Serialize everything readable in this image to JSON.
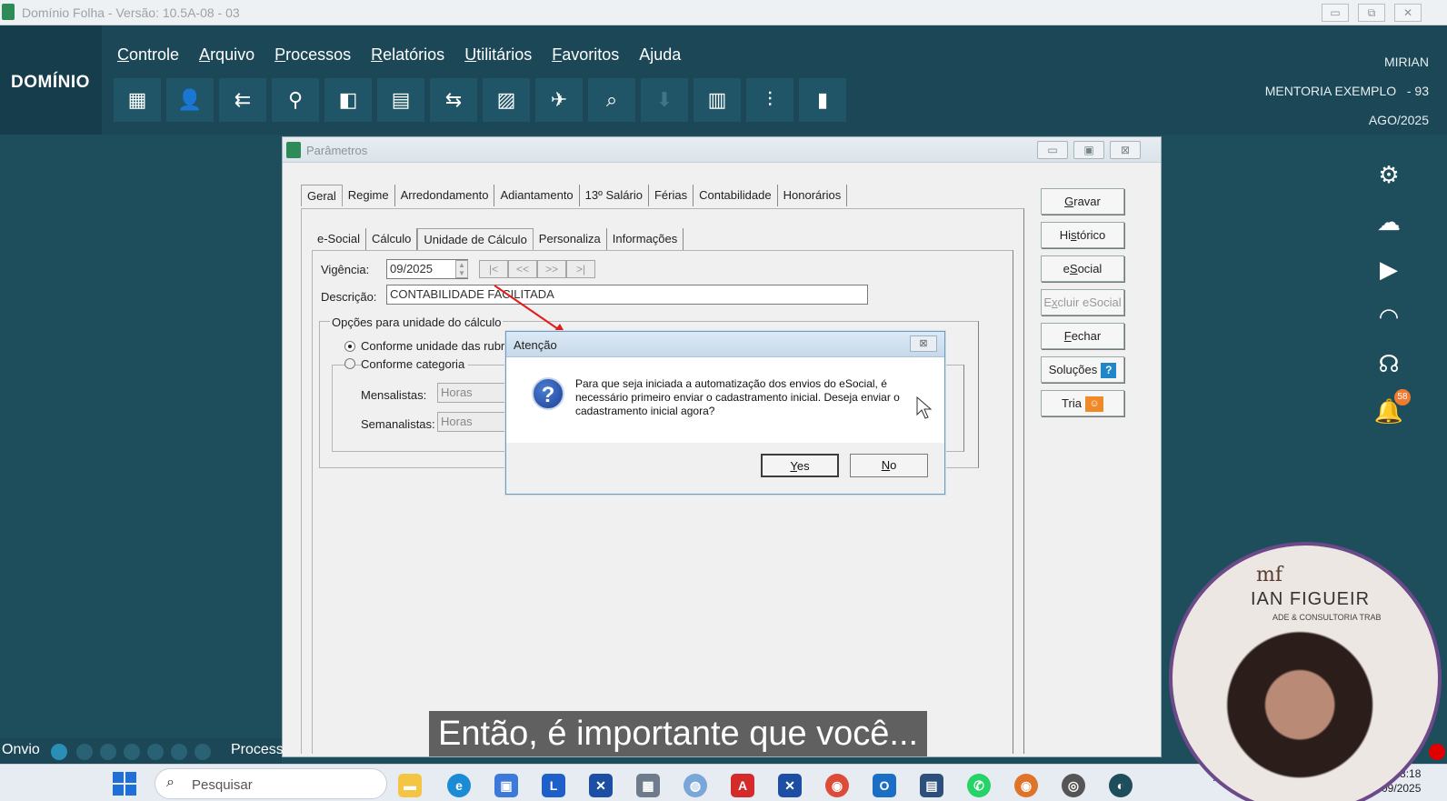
{
  "window_title": "Domínio Folha - Versão: 10.5A-08 - 03",
  "window_controls": [
    "▭",
    "⧉",
    "✕"
  ],
  "brand": "DOMÍNIO",
  "menu": [
    {
      "first": "C",
      "rest": "ontrole"
    },
    {
      "first": "A",
      "rest": "rquivo"
    },
    {
      "first": "P",
      "rest": "rocessos"
    },
    {
      "first": "R",
      "rest": "elatórios"
    },
    {
      "first": "U",
      "rest": "tilitários"
    },
    {
      "first": "F",
      "rest": "avoritos"
    },
    {
      "first": "",
      "rest": "Ajuda"
    }
  ],
  "toolbar_icons": [
    "building-icon",
    "user-icon",
    "entry-icon",
    "user-search-icon",
    "puzzle-icon",
    "spreadsheet-icon",
    "transfer-icon",
    "document-sync-icon",
    "plane-icon",
    "search-icon",
    "download-icon",
    "calculator-icon",
    "chart-search-icon",
    "book-icon"
  ],
  "user": {
    "name": "MIRIAN",
    "company": "MENTORIA EXEMPLO",
    "company_code": "- 93",
    "period": "AGO/2025"
  },
  "right_icons": [
    "gear-icon",
    "cloud-upload-icon",
    "play-icon",
    "helmet-icon",
    "headset-icon",
    "bell-icon"
  ],
  "notifications_count": "58",
  "params_window": {
    "title": "Parâmetros",
    "main_tabs": [
      "Geral",
      "Regime",
      "Arredondamento",
      "Adiantamento",
      "13º Salário",
      "Férias",
      "Contabilidade",
      "Honorários"
    ],
    "sub_tabs": [
      "e-Social",
      "Cálculo",
      "Unidade de Cálculo",
      "Personaliza",
      "Informações"
    ],
    "vigencia_label": "Vigência:",
    "vigencia_value": "09/2025",
    "nav_buttons": [
      "|<",
      "<<",
      ">>",
      ">|"
    ],
    "descricao_label": "Descrição:",
    "descricao_value": "CONTABILIDADE FACILITADA",
    "options_group_label": "Opções para unidade do cálculo",
    "radio1": "Conforme unidade das rubric",
    "radio2": "Conforme categoria",
    "mensalistas_label": "Mensalistas:",
    "mensalistas_value": "Horas",
    "semanalistas_label": "Semanalistas:",
    "semanalistas_value": "Horas",
    "side_buttons": {
      "gravar": {
        "u": "G",
        "rest": "ravar"
      },
      "historico": {
        "pre": "Hi",
        "u": "s",
        "rest": "tórico"
      },
      "esocial": {
        "pre": "e",
        "u": "S",
        "rest": "ocial"
      },
      "excluir": {
        "pre": "E",
        "u": "x",
        "rest": "cluir eSocial"
      },
      "fechar": {
        "u": "F",
        "rest": "echar"
      },
      "solucoes": "Soluções",
      "tria": "Tria"
    }
  },
  "dialog": {
    "title": "Atenção",
    "message": "Para que seja iniciada a automatização dos envios do eSocial, é necessário primeiro enviar o cadastramento inicial. Deseja enviar o cadastramento inicial agora?",
    "yes": {
      "u": "Y",
      "rest": "es"
    },
    "no": {
      "u": "N",
      "rest": "o"
    }
  },
  "statusbar": {
    "onvio": "Onvio",
    "processes": "Process"
  },
  "caption": "Então, é importante que você...",
  "taskbar": {
    "search_placeholder": "Pesquisar",
    "time": "18:18",
    "date": "1/09/2025"
  },
  "webcam": {
    "logo": "mf",
    "brand_name": "IAN FIGUEIR",
    "brand_tag": "ADE & CONSULTORIA TRAB"
  }
}
